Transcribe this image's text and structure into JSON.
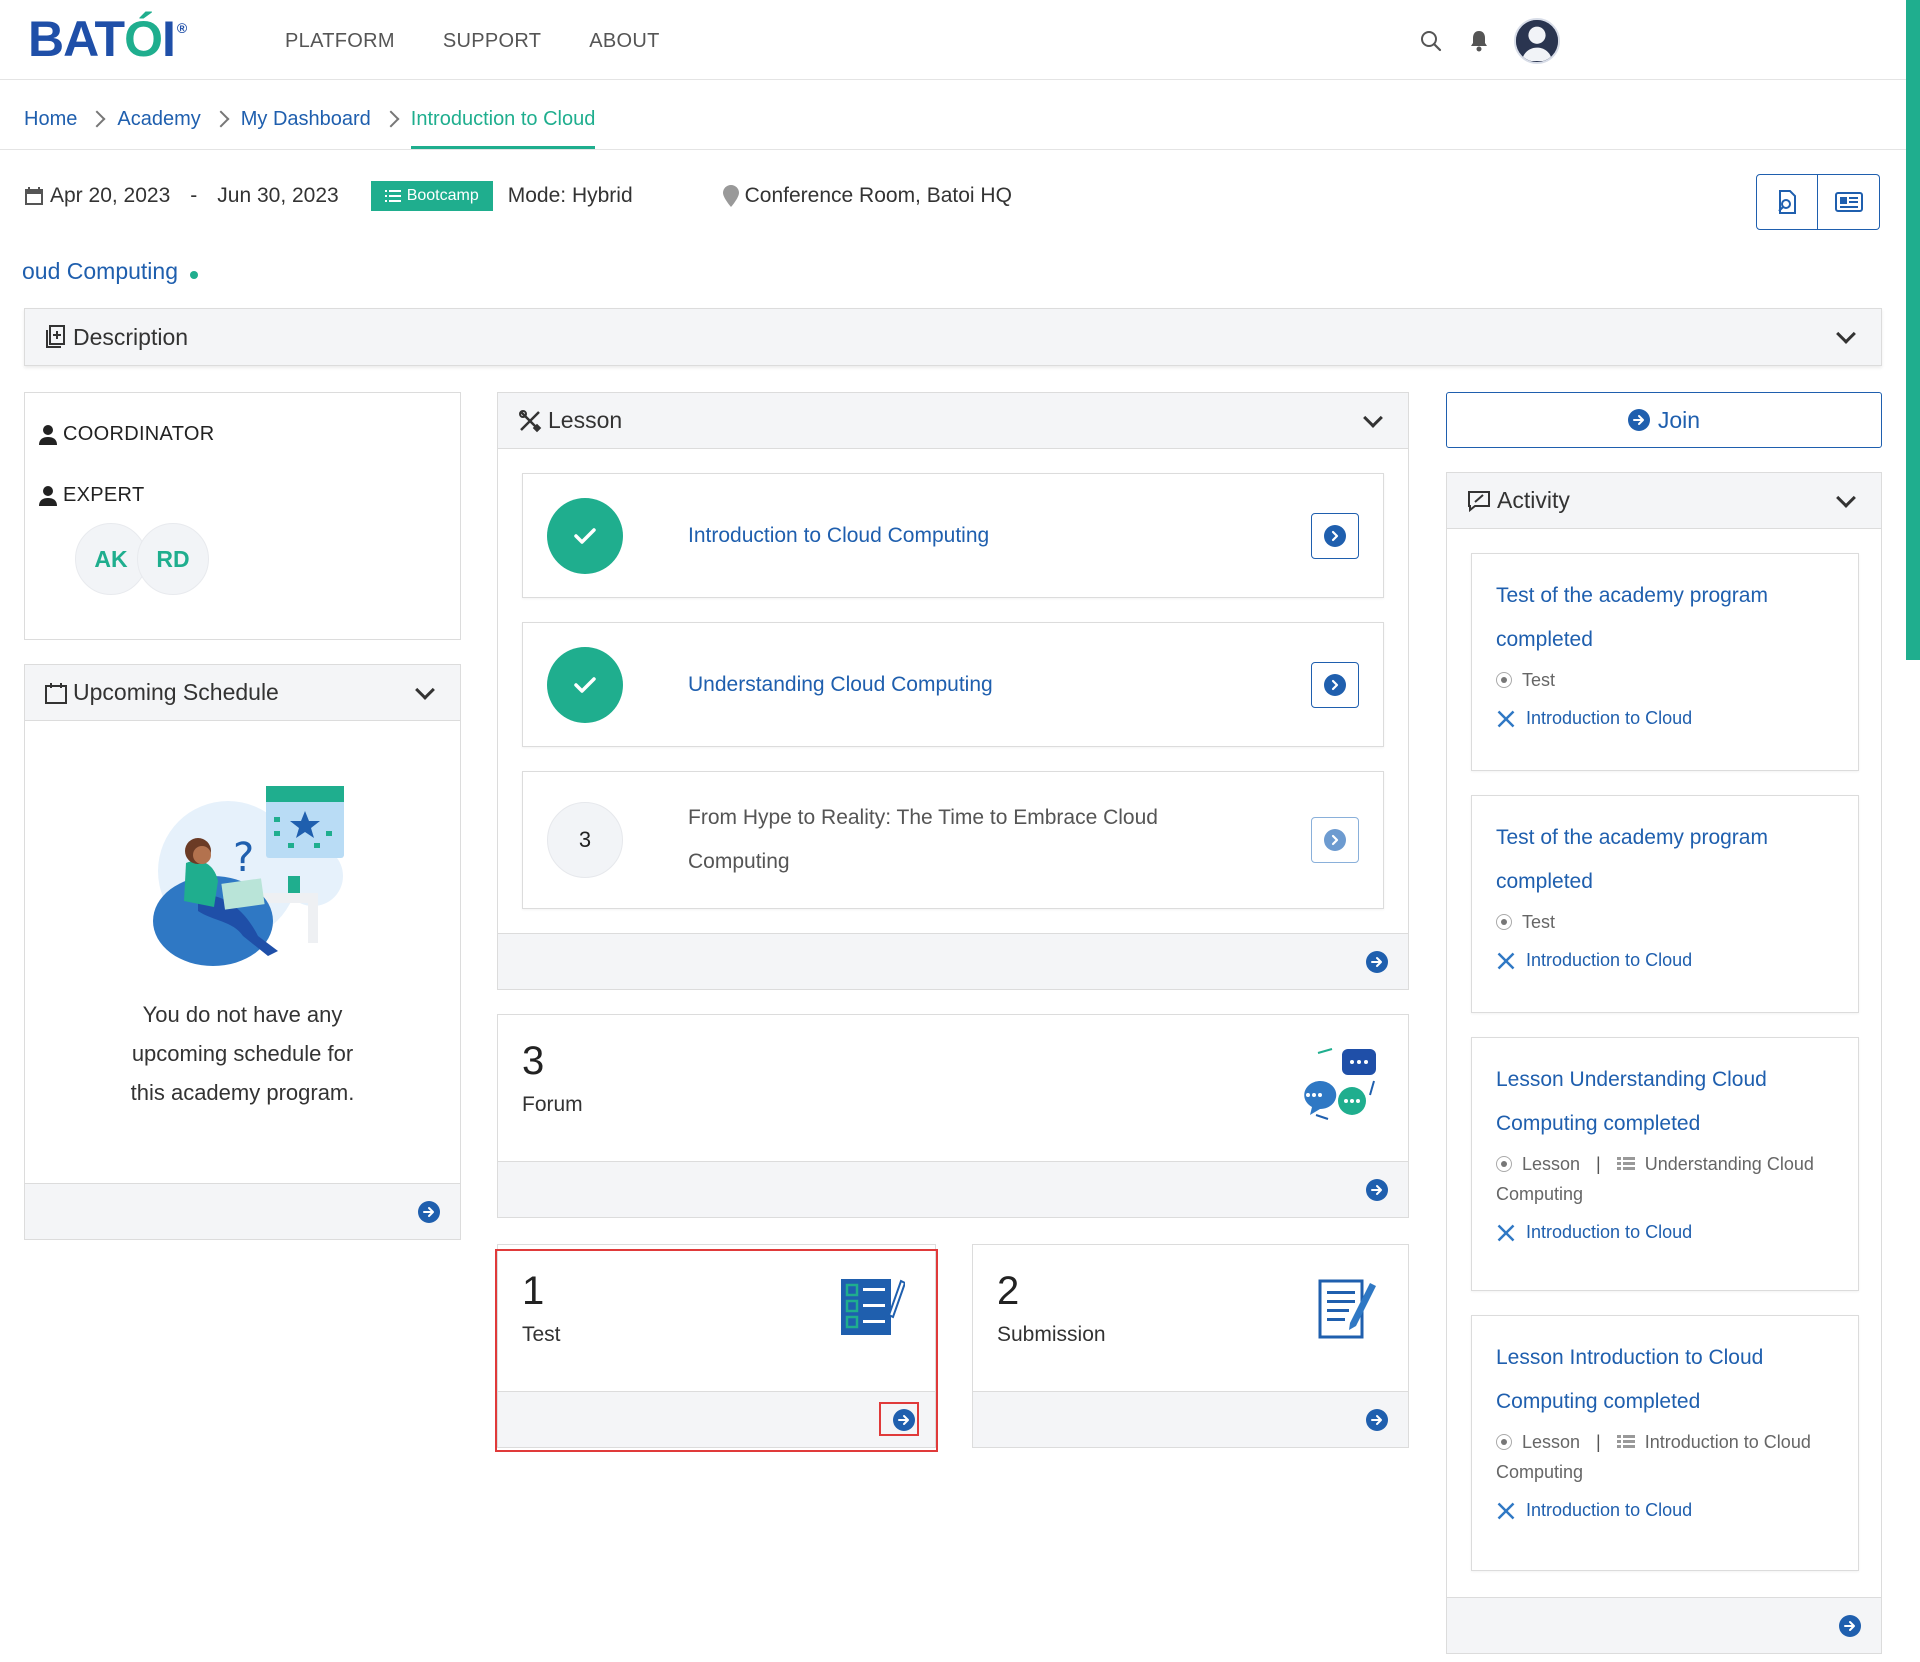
{
  "brand": {
    "logo_text_a": "BAT",
    "logo_text_b": "Ó",
    "logo_text_c": "I",
    "registered": "®",
    "color_primary": "#1f5fae",
    "color_accent": "#1fae8e"
  },
  "nav": {
    "items": [
      "PLATFORM",
      "SUPPORT",
      "ABOUT"
    ]
  },
  "breadcrumb": {
    "items": [
      "Home",
      "Academy",
      "My Dashboard"
    ],
    "active": "Introduction to Cloud"
  },
  "info": {
    "start_date": "Apr 20, 2023",
    "date_separator": "-",
    "end_date": "Jun 30, 2023",
    "badge": "Bootcamp",
    "mode": "Mode: Hybrid",
    "location": "Conference Room, Batoi HQ"
  },
  "course_title": "oud Computing",
  "description": {
    "title": "Description"
  },
  "people": {
    "coordinator_label": "COORDINATOR",
    "expert_label": "EXPERT",
    "initials": [
      "AK",
      "RD"
    ]
  },
  "schedule": {
    "title": "Upcoming Schedule",
    "empty_message": "You do not have any upcoming schedule for this academy program."
  },
  "lesson": {
    "title": "Lesson",
    "items": [
      {
        "name": "Introduction to Cloud Computing",
        "status": "completed",
        "number": ""
      },
      {
        "name": "Understanding Cloud Computing",
        "status": "completed",
        "number": ""
      },
      {
        "name": "From Hype to Reality: The Time to Embrace Cloud Computing",
        "status": "pending",
        "number": "3"
      }
    ]
  },
  "stats": {
    "forum": {
      "count": "3",
      "label": "Forum"
    },
    "test": {
      "count": "1",
      "label": "Test"
    },
    "submission": {
      "count": "2",
      "label": "Submission"
    }
  },
  "join": {
    "label": "Join"
  },
  "activity": {
    "title": "Activity",
    "items": [
      {
        "title": "Test of the academy program completed",
        "type": "Test",
        "extra": "",
        "extra_tail": "",
        "link": "Introduction to Cloud"
      },
      {
        "title": "Test of the academy program completed",
        "type": "Test",
        "extra": "",
        "extra_tail": "",
        "link": "Introduction to Cloud"
      },
      {
        "title": "Lesson Understanding Cloud Computing completed",
        "type": "Lesson",
        "extra": "Understanding Cloud",
        "extra_tail": "Computing",
        "link": "Introduction to Cloud"
      },
      {
        "title": "Lesson Introduction to Cloud Computing completed",
        "type": "Lesson",
        "extra": "Introduction to Cloud",
        "extra_tail": "Computing",
        "link": "Introduction to Cloud"
      }
    ]
  },
  "icons": {
    "search": "search-icon",
    "bell": "bell-icon",
    "user": "user-avatar",
    "calendar": "calendar-icon",
    "list": "list-icon",
    "pin": "map-pin-icon",
    "arrow": "arrow-right-circle-icon",
    "check": "check-icon"
  }
}
